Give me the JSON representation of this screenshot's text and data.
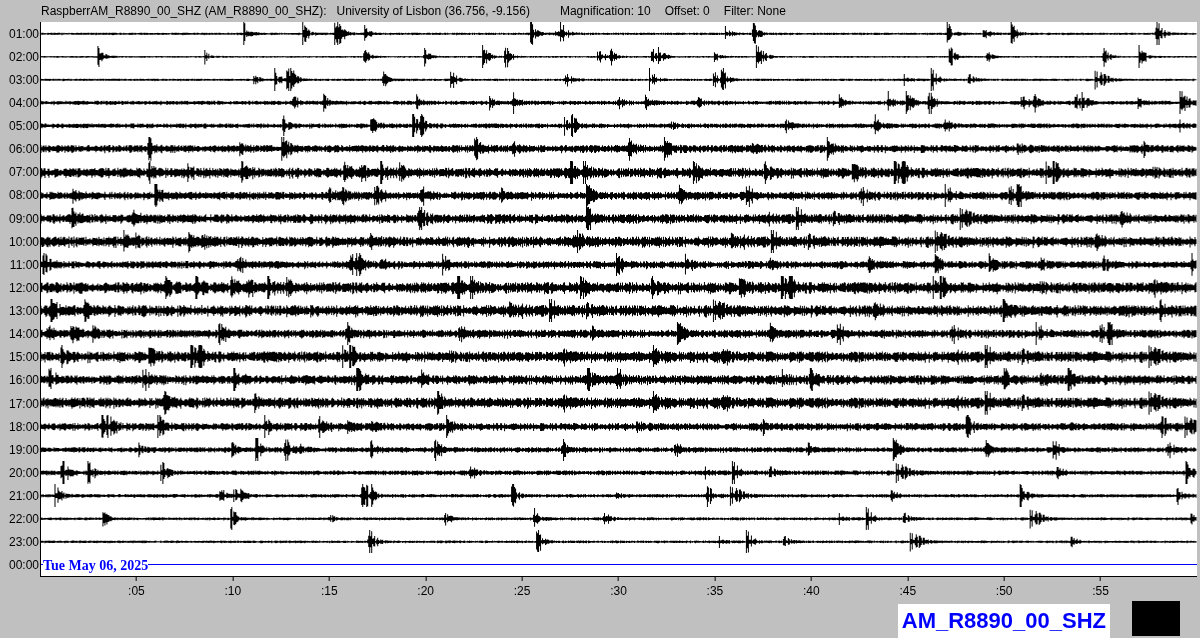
{
  "header": {
    "station": "RaspberrAM_R8890_00_SHZ (AM_R8890_00_SHZ):",
    "location": "University of Lisbon (36.756, -9.156)",
    "magnification": "Magnification: 10",
    "offset": "Offset: 0",
    "filter": "Filter: None"
  },
  "rows": [
    {
      "label": "01:00",
      "kind": "trace"
    },
    {
      "label": "02:00",
      "kind": "trace"
    },
    {
      "label": "03:00",
      "kind": "trace"
    },
    {
      "label": "04:00",
      "kind": "trace"
    },
    {
      "label": "05:00",
      "kind": "trace"
    },
    {
      "label": "06:00",
      "kind": "trace"
    },
    {
      "label": "07:00",
      "kind": "trace"
    },
    {
      "label": "08:00",
      "kind": "trace"
    },
    {
      "label": "09:00",
      "kind": "trace"
    },
    {
      "label": "10:00",
      "kind": "trace"
    },
    {
      "label": "11:00",
      "kind": "trace"
    },
    {
      "label": "12:00",
      "kind": "trace"
    },
    {
      "label": "13:00",
      "kind": "trace"
    },
    {
      "label": "14:00",
      "kind": "trace"
    },
    {
      "label": "15:00",
      "kind": "trace"
    },
    {
      "label": "16:00",
      "kind": "trace"
    },
    {
      "label": "17:00",
      "kind": "trace"
    },
    {
      "label": "18:00",
      "kind": "trace"
    },
    {
      "label": "19:00",
      "kind": "trace"
    },
    {
      "label": "20:00",
      "kind": "trace"
    },
    {
      "label": "21:00",
      "kind": "trace"
    },
    {
      "label": "22:00",
      "kind": "trace"
    },
    {
      "label": "23:00",
      "kind": "trace"
    },
    {
      "label": "00:00",
      "kind": "pending"
    }
  ],
  "date": "Tue May 06, 2025",
  "ticks": [
    ":05",
    ":10",
    ":15",
    ":20",
    ":25",
    ":30",
    ":35",
    ":40",
    ":45",
    ":50",
    ":55"
  ],
  "station_badge": "AM_R8890_00_SHZ"
}
